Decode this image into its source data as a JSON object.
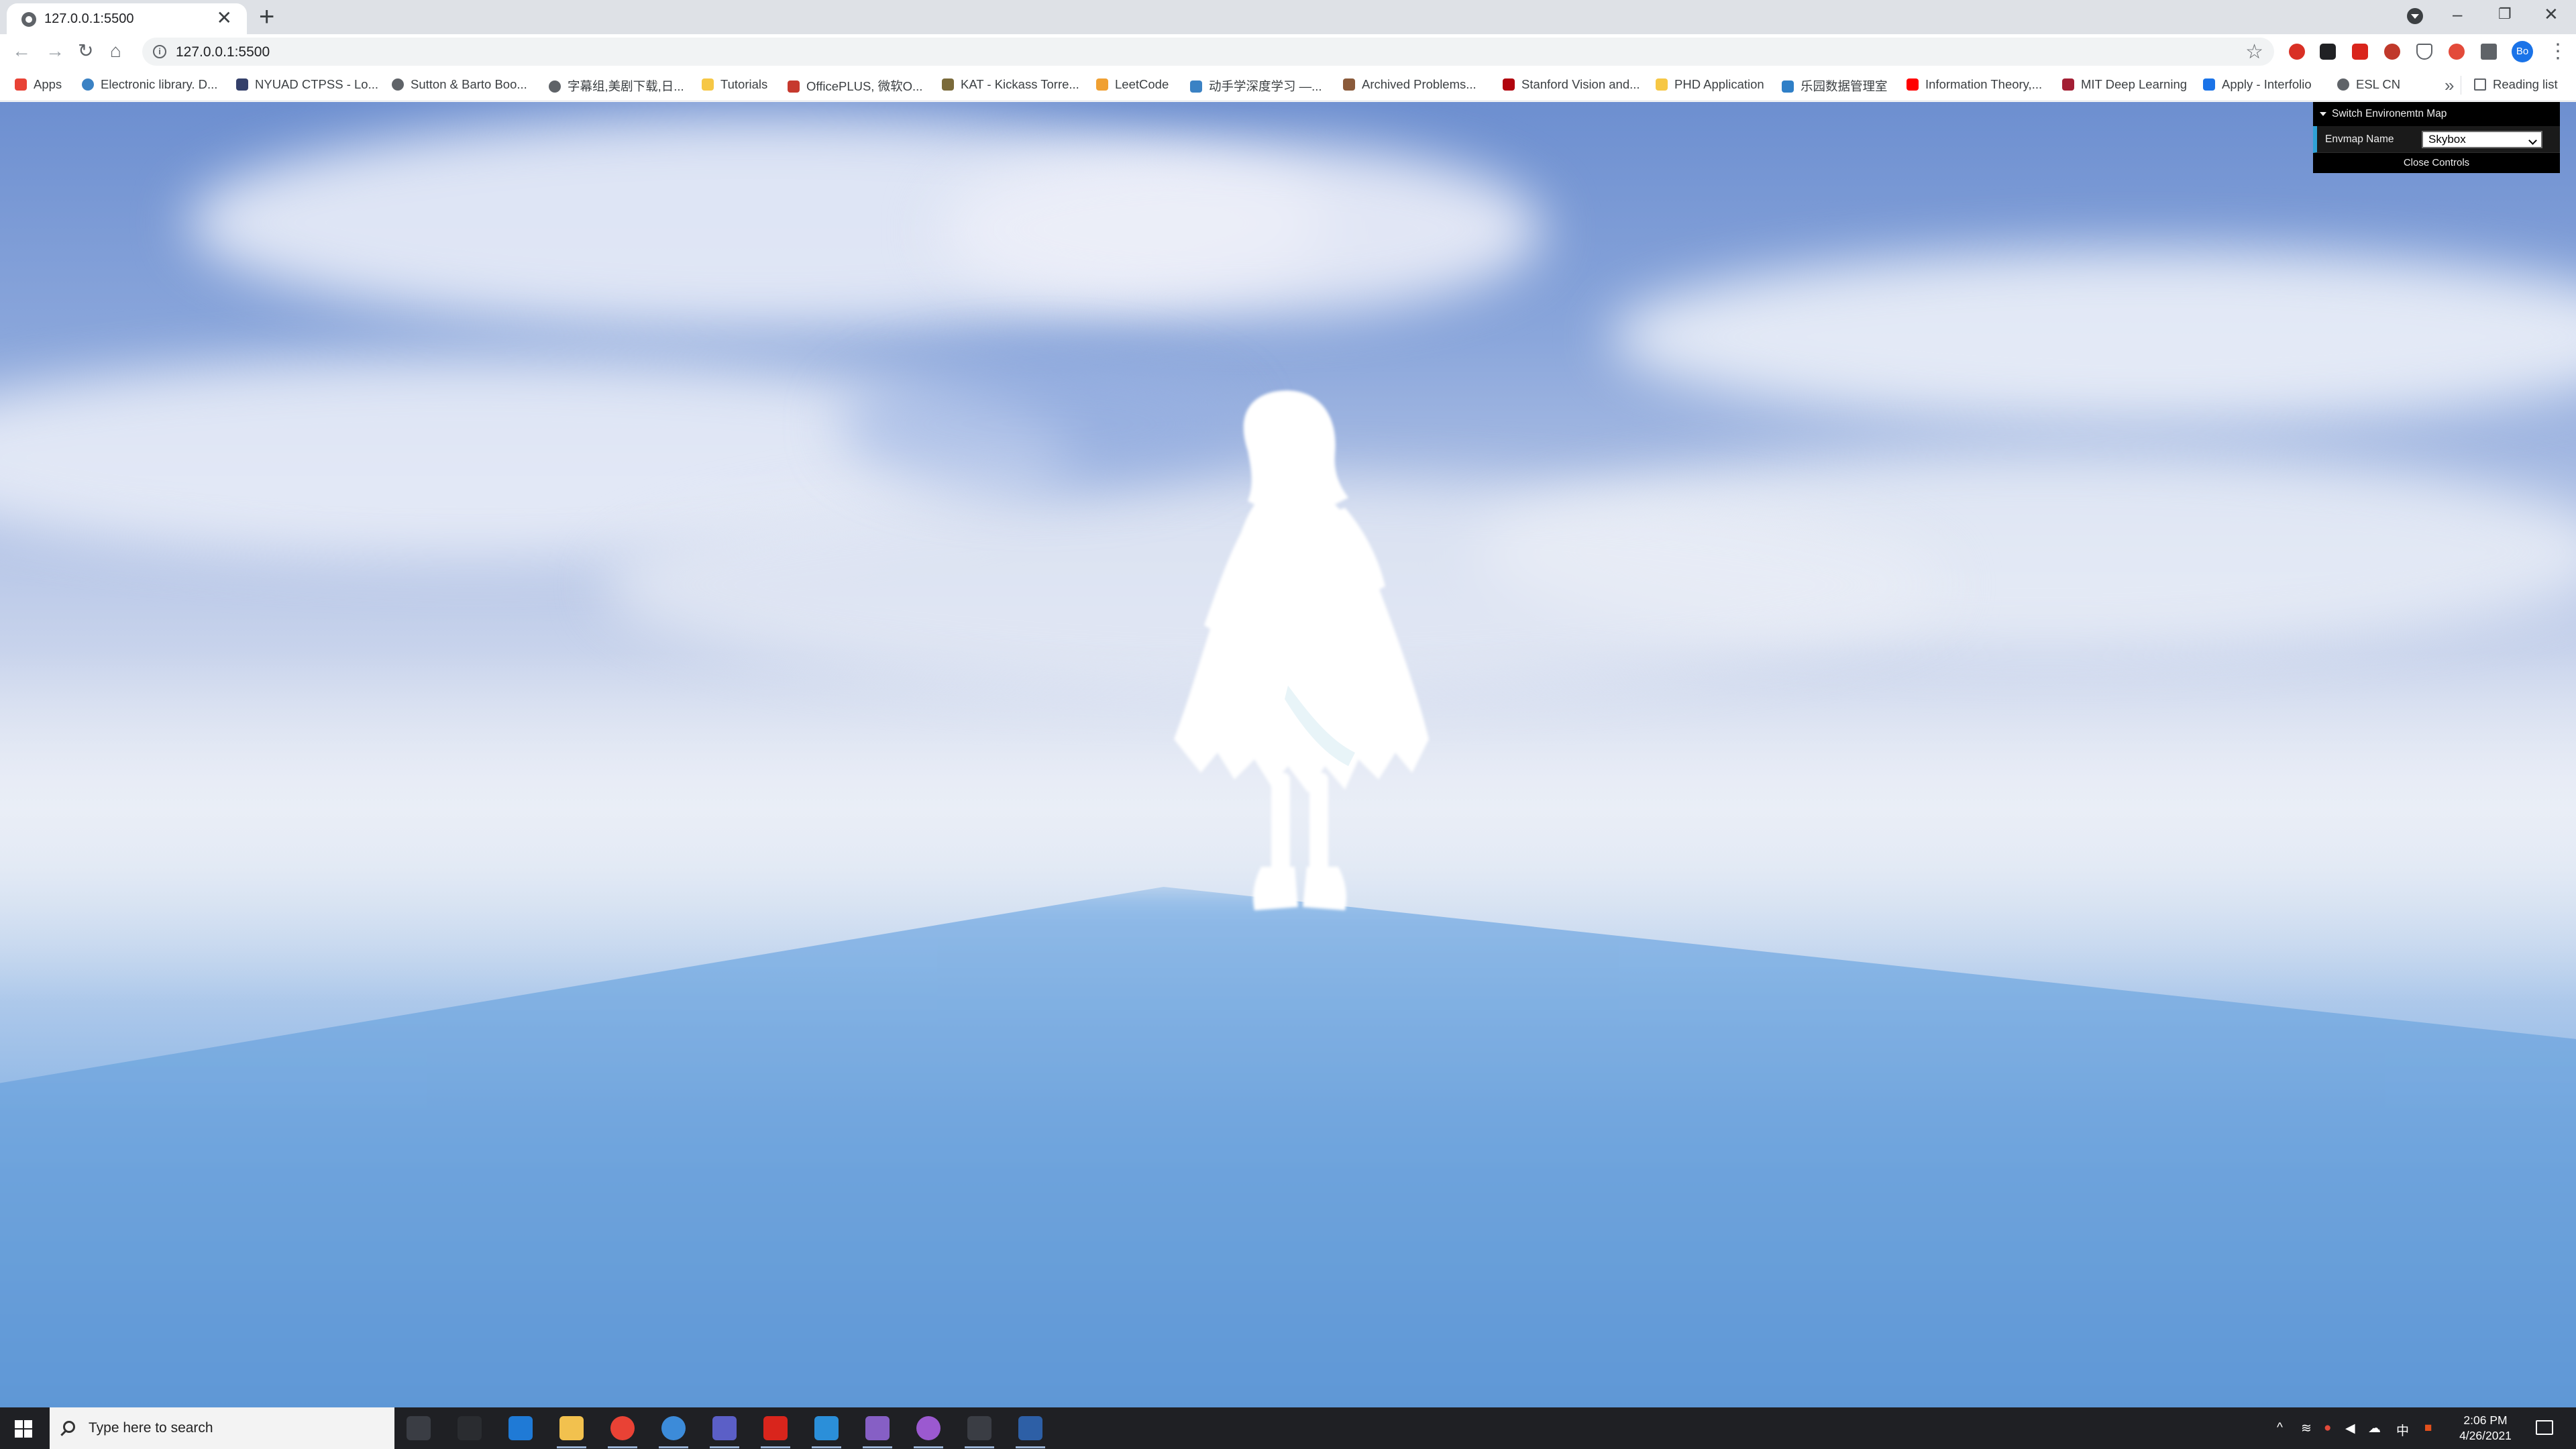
{
  "tab": {
    "title": "127.0.0.1:5500",
    "close": "✕",
    "new_tab": "+"
  },
  "window": {
    "minimize": "–",
    "restore": "❐",
    "close": "✕"
  },
  "toolbar": {
    "back": "←",
    "forward": "→",
    "reload": "↻",
    "home": "⌂",
    "url": "127.0.0.1:5500",
    "avatar_initials": "Bo"
  },
  "bookmarks": [
    {
      "label": "Apps",
      "icon": "apps-grid-icon",
      "color": "#e84235"
    },
    {
      "label": "Electronic library. D...",
      "icon": "globe-icon",
      "color": "#3b82c4"
    },
    {
      "label": "NYUAD CTPSS - Lo...",
      "icon": "bird-icon",
      "color": "#34406a"
    },
    {
      "label": "Sutton & Barto Boo...",
      "icon": "globe-icon",
      "color": "#5f6368"
    },
    {
      "label": "字幕组,美剧下载,日...",
      "icon": "globe-icon",
      "color": "#5f6368"
    },
    {
      "label": "Tutorials",
      "icon": "folder-icon",
      "color": "#f6c744"
    },
    {
      "label": "OfficePLUS, 微软O...",
      "icon": "office-icon",
      "color": "#c6392e"
    },
    {
      "label": "KAT - Kickass Torre...",
      "icon": "shield-icon",
      "color": "#7a6a3a"
    },
    {
      "label": "LeetCode",
      "icon": "leetcode-icon",
      "color": "#f0a032"
    },
    {
      "label": "动手学深度学习 —...",
      "icon": "book-icon",
      "color": "#3b82c4"
    },
    {
      "label": "Archived Problems...",
      "icon": "image-icon",
      "color": "#8a5a3a"
    },
    {
      "label": "Stanford Vision and...",
      "icon": "stanford-icon",
      "color": "#b1040e"
    },
    {
      "label": "PHD Application",
      "icon": "folder-icon",
      "color": "#f6c744"
    },
    {
      "label": "乐园数据管理室",
      "icon": "diamond-icon",
      "color": "#2f7fc7"
    },
    {
      "label": "Information Theory,...",
      "icon": "youtube-icon",
      "color": "#ff0000"
    },
    {
      "label": "MIT Deep Learning",
      "icon": "mit-icon",
      "color": "#a31f34"
    },
    {
      "label": "Apply - Interfolio",
      "icon": "info-icon",
      "color": "#1a73e8"
    },
    {
      "label": "ESL CN",
      "icon": "globe-icon",
      "color": "#5f6368"
    }
  ],
  "bookmarks_more": "»",
  "reading_list": "Reading list",
  "gui": {
    "folder_title": "Switch Environemtn Map",
    "envmap_label": "Envmap Name",
    "envmap_value": "Skybox",
    "close_label": "Close Controls"
  },
  "taskbar": {
    "search_placeholder": "Type here to search",
    "time": "2:06 PM",
    "date": "4/26/2021",
    "ime": "中",
    "apps": [
      {
        "name": "task-view-icon",
        "color": "#3a3d44"
      },
      {
        "name": "mail-icon",
        "color": "#2a2c30"
      },
      {
        "name": "edge-icon",
        "color": "#1f7ad6"
      },
      {
        "name": "file-explorer-icon",
        "color": "#f2c14e"
      },
      {
        "name": "chrome-icon",
        "color": "#e94235"
      },
      {
        "name": "app-icon",
        "color": "#3c8bd9"
      },
      {
        "name": "teams-icon",
        "color": "#5b5fc7"
      },
      {
        "name": "acrobat-icon",
        "color": "#d9251c"
      },
      {
        "name": "vscode-icon",
        "color": "#2b8fd9"
      },
      {
        "name": "visual-studio-icon",
        "color": "#865fc5"
      },
      {
        "name": "github-desktop-icon",
        "color": "#9b59d0"
      },
      {
        "name": "settings-icon",
        "color": "#3a3d44"
      },
      {
        "name": "powershell-icon",
        "color": "#2d5fa6"
      }
    ]
  },
  "colors": {
    "gui_accent": "#2fa1d6",
    "sky_top": "#6d8fd0",
    "ground": "#5b94d4"
  }
}
